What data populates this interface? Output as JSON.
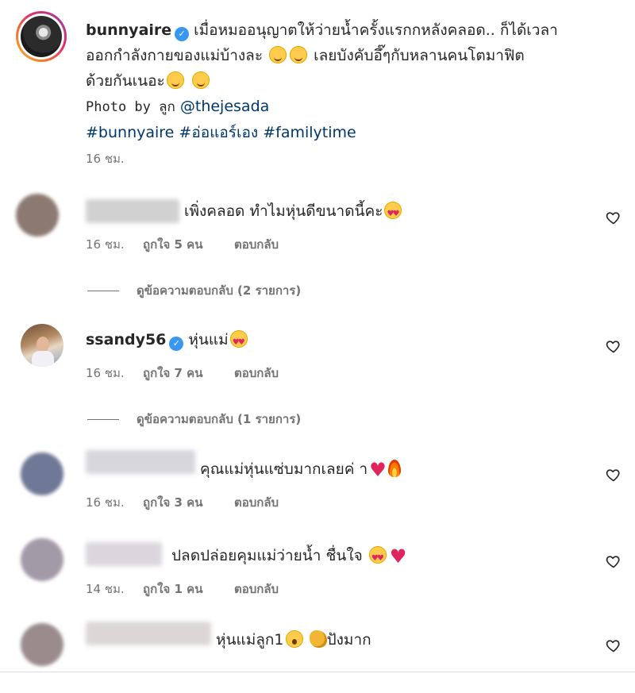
{
  "post": {
    "username": "bunnyaire",
    "caption_line1": "เมื่อหมออนุญาตให้ว่ายน้ำครั้งแรกกหลังคลอด.. ก็ได้เวลา",
    "caption_line2": "ออกกำลังกายของแม่บ้างละ",
    "caption_line2b": "เลยบังคับอึ๊ๆกับหลานคนโตมาฟิต",
    "caption_line3": "ด้วยกันเนอะ",
    "photo_by_prefix": "Photo by ลูก",
    "photo_by_handle": "@thejesada",
    "hashtags": "#bunnyaire #อ่อแอร์เอง #familytime",
    "time": "16 ชม."
  },
  "comments": [
    {
      "username": "",
      "text": "เพิ่งคลอด ทำไมหุ่นดีขนาดนี้คะ",
      "time": "16 ชม.",
      "likes": "ถูกใจ 5 คน",
      "reply": "ตอบกลับ",
      "view_replies": "ดูข้อความตอบกลับ (2 รายการ)",
      "avatar_color": "#8c7a72",
      "name_color": "#c9c9c9"
    },
    {
      "username": "ssandy56",
      "text": "หุ่นแม่",
      "time": "16 ชม.",
      "likes": "ถูกใจ 7 คน",
      "reply": "ตอบกลับ",
      "view_replies": "ดูข้อความตอบกลับ (1 รายการ)"
    },
    {
      "username": "",
      "text": "คุณแม่หุ่นแซ่บมากเลยค่ า",
      "time": "16 ชม.",
      "likes": "ถูกใจ 3 คน",
      "reply": "ตอบกลับ",
      "avatar_color": "#6f7896",
      "name_color": "#cfcfd6"
    },
    {
      "username": "",
      "text": "ปลดปล่อยคุมแม่ว่ายน้ำ ชื่นใจ",
      "time": "14 ชม.",
      "likes": "ถูกใจ 1 คน",
      "reply": "ตอบกลับ",
      "avatar_color": "#a39aa8",
      "name_color": "#d4d0d6"
    },
    {
      "username": "",
      "text": "หุ่นแม่ลูก1",
      "text_b": "ปังมาก",
      "time": "",
      "likes": "",
      "reply": "",
      "avatar_color": "#9a8c8c",
      "name_color": "#d6d0d0"
    }
  ],
  "icons": {
    "verified": "verified-badge-icon",
    "like": "heart-outline-icon"
  },
  "colors": {
    "verified": "#3897f0",
    "link": "#00376b",
    "meta": "#737373",
    "heart": "#e0245e"
  }
}
